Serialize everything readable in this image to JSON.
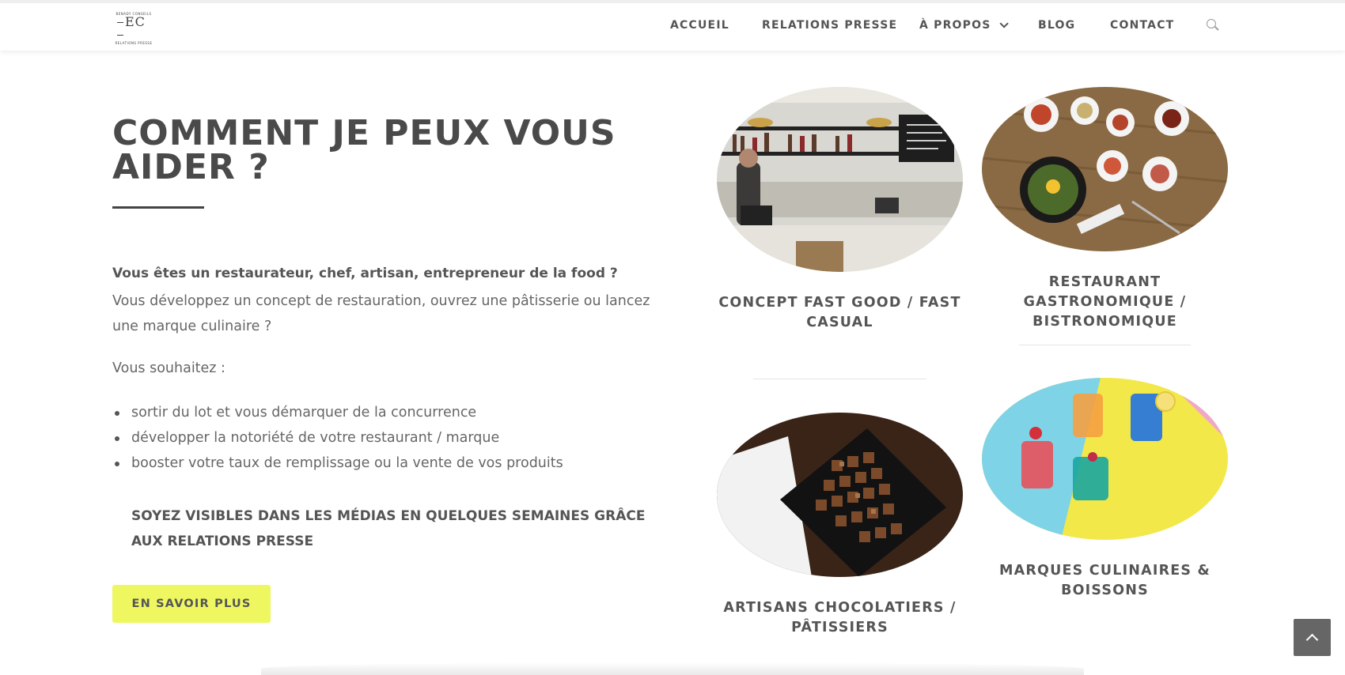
{
  "header": {
    "logo": {
      "top_text": "BENADY CONSEILS",
      "mark": "EC",
      "sub_text": "RELATIONS PRESSE"
    },
    "nav": [
      {
        "label": "ACCUEIL"
      },
      {
        "label": "RELATIONS PRESSE"
      },
      {
        "label": "À PROPOS",
        "has_dropdown": true
      },
      {
        "label": "BLOG"
      },
      {
        "label": "CONTACT"
      }
    ],
    "search_icon": "search-icon"
  },
  "main": {
    "heading_line1": "COMMENT JE PEUX VOUS",
    "heading_line2": "AIDER ?",
    "intro_strong": "Vous êtes un restaurateur, chef, artisan, entrepreneur de la food ?",
    "intro_text": "Vous développez un concept de restauration, ouvrez une pâtisserie ou lancez une marque culinaire ?",
    "wish_label": "Vous souhaitez :",
    "bullets": [
      "sortir du lot et vous démarquer de la concurrence",
      "développer la notoriété de votre restaurant / marque",
      "booster votre taux de remplissage ou la vente de vos produits"
    ],
    "highlight": "SOYEZ VISIBLES DANS LES MÉDIAS EN QUELQUES SEMAINES GRÂCE AUX RELATIONS PRESSE",
    "cta_label": "EN SAVOIR PLUS"
  },
  "cards": [
    {
      "title": "CONCEPT FAST GOOD / FAST CASUAL",
      "image": "cafe-counter-photo"
    },
    {
      "title": "RESTAURANT GASTRONOMIQUE / BISTRONOMIQUE",
      "image": "korean-dishes-photo"
    },
    {
      "title": "ARTISANS CHOCOLATIERS / PÂTISSIERS",
      "image": "chocolate-box-photo"
    },
    {
      "title": "MARQUES CULINAIRES & BOISSONS",
      "image": "colorful-drinks-photo"
    }
  ],
  "colors": {
    "accent": "#eef760",
    "text": "#555555",
    "heading": "#4a4a4a"
  },
  "back_to_top_icon": "chevron-up-icon"
}
